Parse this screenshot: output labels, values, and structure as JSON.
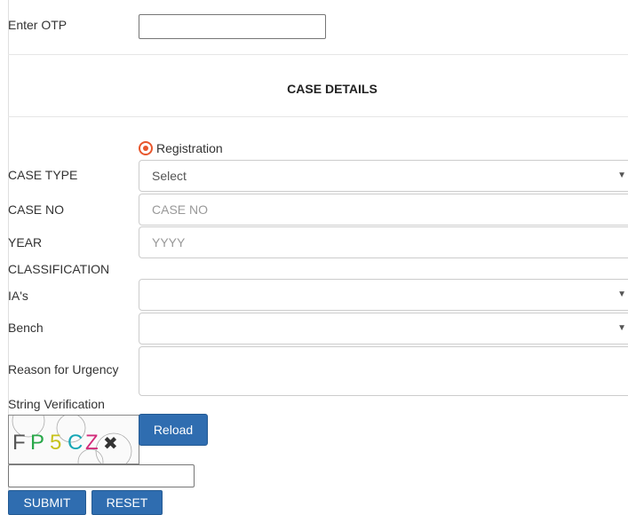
{
  "otp": {
    "label": "Enter OTP",
    "value": ""
  },
  "case_details": {
    "title": "CASE DETAILS",
    "radio_option": "Registration",
    "case_type": {
      "label": "CASE TYPE",
      "selected": "Select"
    },
    "case_no": {
      "label": "CASE NO",
      "placeholder": "CASE NO"
    },
    "year": {
      "label": "YEAR",
      "placeholder": "YYYY"
    },
    "classification": {
      "label": "CLASSIFICATION"
    },
    "ias": {
      "label": "IA's",
      "selected": ""
    },
    "bench": {
      "label": "Bench",
      "selected": ""
    },
    "reason": {
      "label": "Reason for Urgency",
      "value": ""
    }
  },
  "verification": {
    "label": "String Verification",
    "captcha_text": "FP5CZ✖",
    "reload_label": "Reload",
    "input_value": ""
  },
  "actions": {
    "submit_label": "SUBMIT",
    "reset_label": "RESET"
  },
  "colors": {
    "primary_button": "#2f6db0",
    "radio_accent": "#e8572d"
  }
}
